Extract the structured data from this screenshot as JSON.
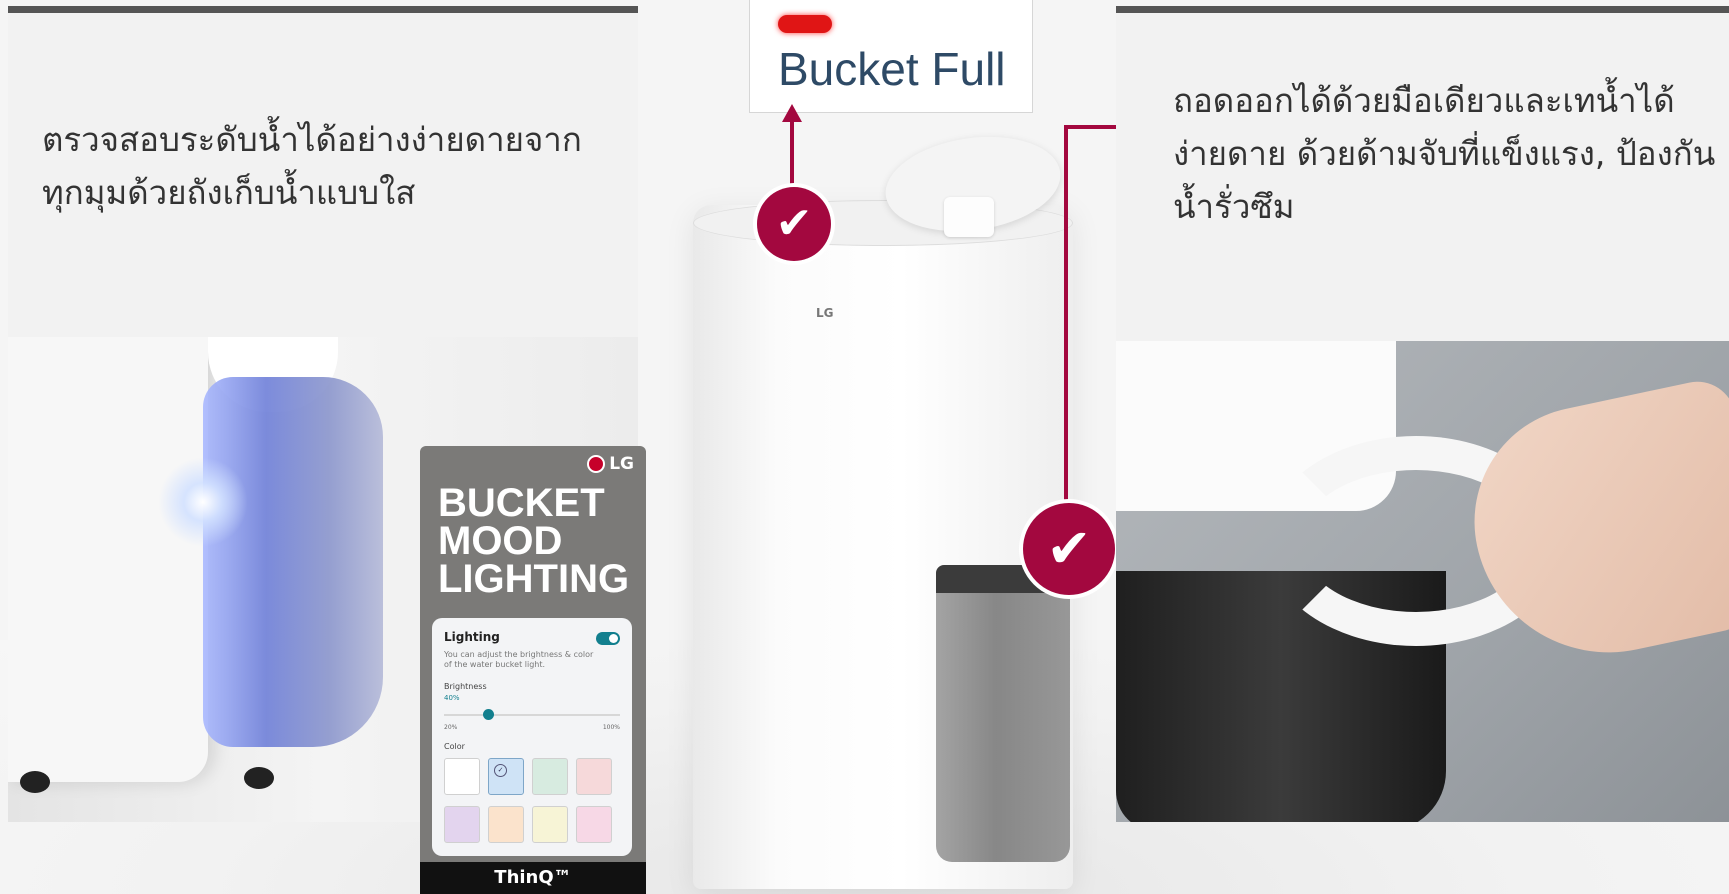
{
  "left_panel": {
    "caption_line1": "ตรวจสอบระดับน้ำได้อย่างง่ายดายจาก",
    "caption_line2": "ทุกมุมด้วยถังเก็บน้ำแบบใส"
  },
  "lighting_card": {
    "brand": "LG",
    "title_line1": "BUCKET",
    "title_line2": "MOOD",
    "title_line3": "LIGHTING",
    "ui": {
      "title": "Lighting",
      "toggle_on": true,
      "description": "You can adjust the brightness & color of the water bucket light.",
      "brightness_label": "Brightness",
      "brightness_value": "40%",
      "brightness_fraction": 0.25,
      "min_label": "20%",
      "max_label": "100%",
      "color_label": "Color",
      "swatches": [
        "#ffffff",
        "#cfe3f6",
        "#d7ebe0",
        "#f6d9da",
        "#e3d4ee",
        "#fbe3cc",
        "#f7f4d6",
        "#f7d8e6"
      ],
      "selected_swatch": 1
    },
    "footer": "ThinQ™"
  },
  "center_product": {
    "notice_text": "Bucket Full",
    "brand_mark": "LG",
    "accent_color": "#a3083f",
    "led_color": "#e01515"
  },
  "right_panel": {
    "caption_line1": "ถอดออกได้ด้วยมือเดียวและเทน้ำได้",
    "caption_line2": "ง่ายดาย ด้วยด้ามจับที่แข็งแรง, ป้องกัน",
    "caption_line3": "น้ำรั่วซึม"
  },
  "icons": {
    "check_badge_top": "check-circle-icon",
    "check_badge_bottom": "check-circle-icon",
    "arrow_up": "arrow-up-icon",
    "arrow_right": "arrow-right-icon"
  }
}
